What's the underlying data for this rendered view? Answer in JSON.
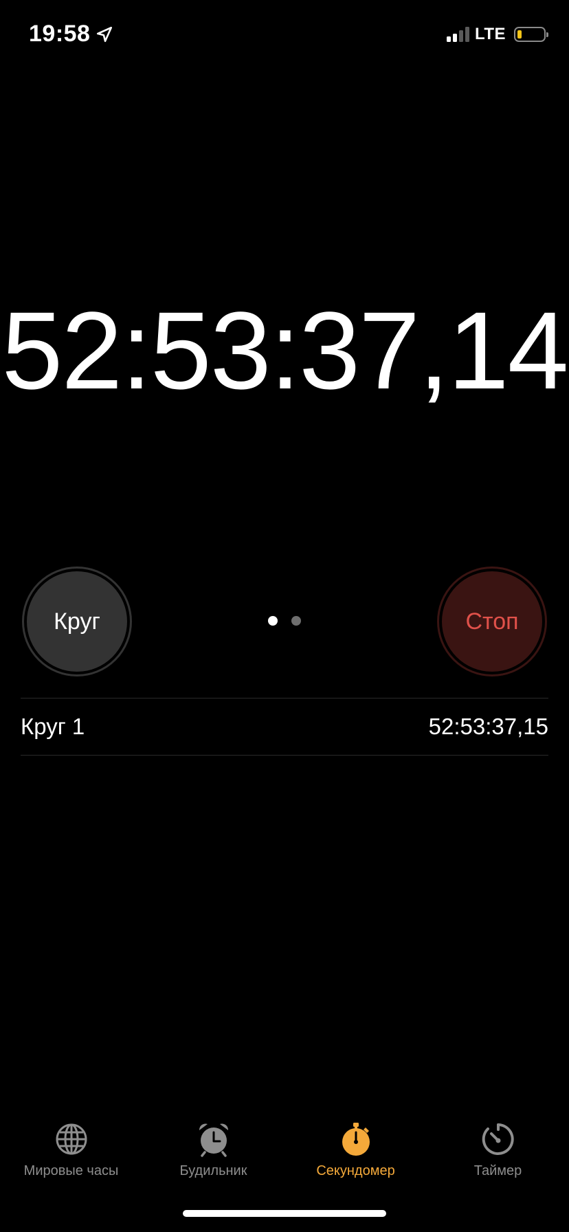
{
  "status_bar": {
    "time": "19:58",
    "network": "LTE",
    "location_icon": "location-arrow-icon",
    "signal_icon": "cellular-signal-icon",
    "battery_icon": "battery-low-icon",
    "battery_color": "#f5c518"
  },
  "stopwatch": {
    "elapsed": "52:53:37,14"
  },
  "controls": {
    "lap_label": "Круг",
    "stop_label": "Стоп",
    "stop_color": "#e0514a",
    "page_dots": {
      "active_index": 0,
      "count": 2
    }
  },
  "laps": [
    {
      "label": "Круг 1",
      "time": "52:53:37,15"
    }
  ],
  "tabbar": {
    "accent_color": "#f4a93a",
    "inactive_color": "#8e8e8e",
    "tabs": [
      {
        "label": "Мировые часы",
        "icon": "globe-icon",
        "active": false
      },
      {
        "label": "Будильник",
        "icon": "alarm-clock-icon",
        "active": false
      },
      {
        "label": "Секундомер",
        "icon": "stopwatch-icon",
        "active": true
      },
      {
        "label": "Таймер",
        "icon": "timer-icon",
        "active": false
      }
    ]
  }
}
